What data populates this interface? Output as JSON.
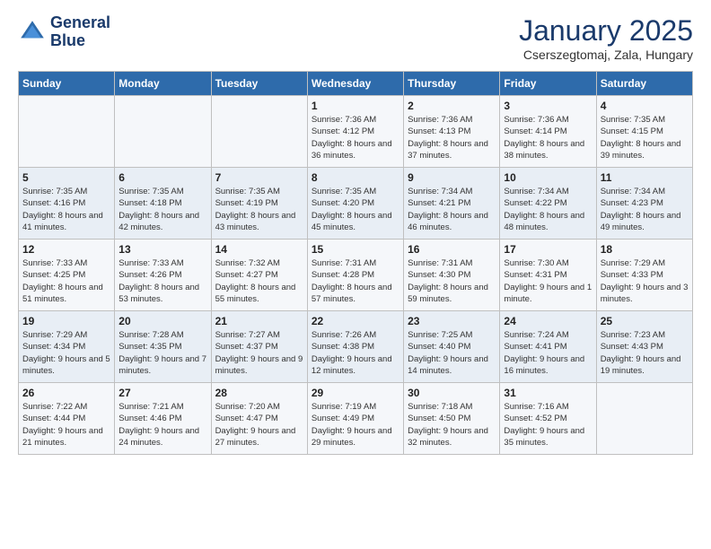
{
  "header": {
    "logo_line1": "General",
    "logo_line2": "Blue",
    "month": "January 2025",
    "location": "Cserszegtomaj, Zala, Hungary"
  },
  "weekdays": [
    "Sunday",
    "Monday",
    "Tuesday",
    "Wednesday",
    "Thursday",
    "Friday",
    "Saturday"
  ],
  "weeks": [
    [
      null,
      null,
      null,
      {
        "day": 1,
        "sunrise": "7:36 AM",
        "sunset": "4:12 PM",
        "daylight": "8 hours and 36 minutes."
      },
      {
        "day": 2,
        "sunrise": "7:36 AM",
        "sunset": "4:13 PM",
        "daylight": "8 hours and 37 minutes."
      },
      {
        "day": 3,
        "sunrise": "7:36 AM",
        "sunset": "4:14 PM",
        "daylight": "8 hours and 38 minutes."
      },
      {
        "day": 4,
        "sunrise": "7:35 AM",
        "sunset": "4:15 PM",
        "daylight": "8 hours and 39 minutes."
      }
    ],
    [
      {
        "day": 5,
        "sunrise": "7:35 AM",
        "sunset": "4:16 PM",
        "daylight": "8 hours and 41 minutes."
      },
      {
        "day": 6,
        "sunrise": "7:35 AM",
        "sunset": "4:18 PM",
        "daylight": "8 hours and 42 minutes."
      },
      {
        "day": 7,
        "sunrise": "7:35 AM",
        "sunset": "4:19 PM",
        "daylight": "8 hours and 43 minutes."
      },
      {
        "day": 8,
        "sunrise": "7:35 AM",
        "sunset": "4:20 PM",
        "daylight": "8 hours and 45 minutes."
      },
      {
        "day": 9,
        "sunrise": "7:34 AM",
        "sunset": "4:21 PM",
        "daylight": "8 hours and 46 minutes."
      },
      {
        "day": 10,
        "sunrise": "7:34 AM",
        "sunset": "4:22 PM",
        "daylight": "8 hours and 48 minutes."
      },
      {
        "day": 11,
        "sunrise": "7:34 AM",
        "sunset": "4:23 PM",
        "daylight": "8 hours and 49 minutes."
      }
    ],
    [
      {
        "day": 12,
        "sunrise": "7:33 AM",
        "sunset": "4:25 PM",
        "daylight": "8 hours and 51 minutes."
      },
      {
        "day": 13,
        "sunrise": "7:33 AM",
        "sunset": "4:26 PM",
        "daylight": "8 hours and 53 minutes."
      },
      {
        "day": 14,
        "sunrise": "7:32 AM",
        "sunset": "4:27 PM",
        "daylight": "8 hours and 55 minutes."
      },
      {
        "day": 15,
        "sunrise": "7:31 AM",
        "sunset": "4:28 PM",
        "daylight": "8 hours and 57 minutes."
      },
      {
        "day": 16,
        "sunrise": "7:31 AM",
        "sunset": "4:30 PM",
        "daylight": "8 hours and 59 minutes."
      },
      {
        "day": 17,
        "sunrise": "7:30 AM",
        "sunset": "4:31 PM",
        "daylight": "9 hours and 1 minute."
      },
      {
        "day": 18,
        "sunrise": "7:29 AM",
        "sunset": "4:33 PM",
        "daylight": "9 hours and 3 minutes."
      }
    ],
    [
      {
        "day": 19,
        "sunrise": "7:29 AM",
        "sunset": "4:34 PM",
        "daylight": "9 hours and 5 minutes."
      },
      {
        "day": 20,
        "sunrise": "7:28 AM",
        "sunset": "4:35 PM",
        "daylight": "9 hours and 7 minutes."
      },
      {
        "day": 21,
        "sunrise": "7:27 AM",
        "sunset": "4:37 PM",
        "daylight": "9 hours and 9 minutes."
      },
      {
        "day": 22,
        "sunrise": "7:26 AM",
        "sunset": "4:38 PM",
        "daylight": "9 hours and 12 minutes."
      },
      {
        "day": 23,
        "sunrise": "7:25 AM",
        "sunset": "4:40 PM",
        "daylight": "9 hours and 14 minutes."
      },
      {
        "day": 24,
        "sunrise": "7:24 AM",
        "sunset": "4:41 PM",
        "daylight": "9 hours and 16 minutes."
      },
      {
        "day": 25,
        "sunrise": "7:23 AM",
        "sunset": "4:43 PM",
        "daylight": "9 hours and 19 minutes."
      }
    ],
    [
      {
        "day": 26,
        "sunrise": "7:22 AM",
        "sunset": "4:44 PM",
        "daylight": "9 hours and 21 minutes."
      },
      {
        "day": 27,
        "sunrise": "7:21 AM",
        "sunset": "4:46 PM",
        "daylight": "9 hours and 24 minutes."
      },
      {
        "day": 28,
        "sunrise": "7:20 AM",
        "sunset": "4:47 PM",
        "daylight": "9 hours and 27 minutes."
      },
      {
        "day": 29,
        "sunrise": "7:19 AM",
        "sunset": "4:49 PM",
        "daylight": "9 hours and 29 minutes."
      },
      {
        "day": 30,
        "sunrise": "7:18 AM",
        "sunset": "4:50 PM",
        "daylight": "9 hours and 32 minutes."
      },
      {
        "day": 31,
        "sunrise": "7:16 AM",
        "sunset": "4:52 PM",
        "daylight": "9 hours and 35 minutes."
      },
      null
    ]
  ]
}
